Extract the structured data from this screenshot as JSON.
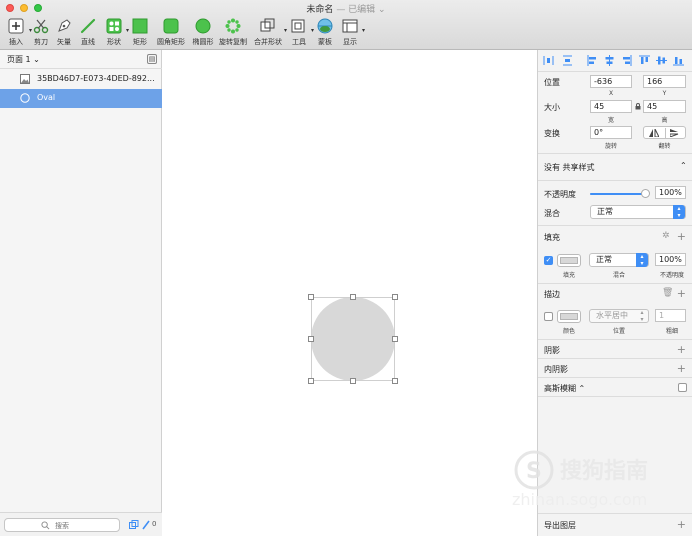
{
  "window": {
    "title": "未命名",
    "status": "— 已编辑 ⌄"
  },
  "toolbar": {
    "items": [
      {
        "label": "插入",
        "icon": "insert-icon"
      },
      {
        "label": "剪刀",
        "icon": "scissors-icon"
      },
      {
        "label": "矢量",
        "icon": "vector-pen-icon"
      },
      {
        "label": "直线",
        "icon": "line-icon"
      },
      {
        "label": "形状",
        "icon": "shapes-icon"
      },
      {
        "label": "矩形",
        "icon": "rectangle-icon"
      },
      {
        "label": "圆角矩形",
        "icon": "rounded-rectangle-icon"
      },
      {
        "label": "椭圆形",
        "icon": "oval-icon"
      },
      {
        "label": "旋转复制",
        "icon": "rotate-copies-icon"
      },
      {
        "label": "合并形状",
        "icon": "combine-shapes-icon"
      },
      {
        "label": "工具",
        "icon": "tools-icon"
      },
      {
        "label": "蒙板",
        "icon": "mask-icon"
      },
      {
        "label": "显示",
        "icon": "view-icon"
      }
    ]
  },
  "pages": {
    "current": "页面 1 ⌄"
  },
  "layers": [
    {
      "name": "35BD46D7-E073-4DED-892...",
      "icon": "image-layer-icon",
      "selected": false
    },
    {
      "name": "Oval",
      "icon": "oval-layer-icon",
      "selected": true
    }
  ],
  "layer_search": {
    "placeholder": "搜索",
    "count": "0"
  },
  "inspector": {
    "position": {
      "label": "位置",
      "x": "-636",
      "y": "166",
      "x_caption": "X",
      "y_caption": "Y"
    },
    "size": {
      "label": "大小",
      "w": "45",
      "h": "45",
      "w_caption": "宽",
      "h_caption": "高"
    },
    "transform": {
      "label": "变换",
      "rotation": "0°",
      "rotation_caption": "旋转",
      "flip_caption": "翻转"
    },
    "shared_style": "没有 共享样式",
    "opacity": {
      "label": "不透明度",
      "value": "100%",
      "fraction": 1.0
    },
    "blending": {
      "label": "混合",
      "value": "正常"
    },
    "fill": {
      "title": "填充",
      "enabled": true,
      "color": "#d8d8d8",
      "blend": "正常",
      "opacity": "100%",
      "captions": [
        "填充",
        "混合",
        "不透明度"
      ]
    },
    "border": {
      "title": "描边",
      "enabled": false,
      "color": "#d8d8d8",
      "position": "水平居中",
      "thickness": "1",
      "captions": [
        "颜色",
        "位置",
        "粗细"
      ]
    },
    "shadow": "阴影",
    "inner_shadow": "内阴影",
    "blur": "高斯模糊 ⌃",
    "export": "导出图层"
  },
  "watermark": {
    "brand": "搜狗指南",
    "url": "zhinan.sogo.com"
  },
  "colors": {
    "accent": "#3f8ef5",
    "selection": "#6da2e8",
    "oval_fill": "#d8d8d8"
  }
}
